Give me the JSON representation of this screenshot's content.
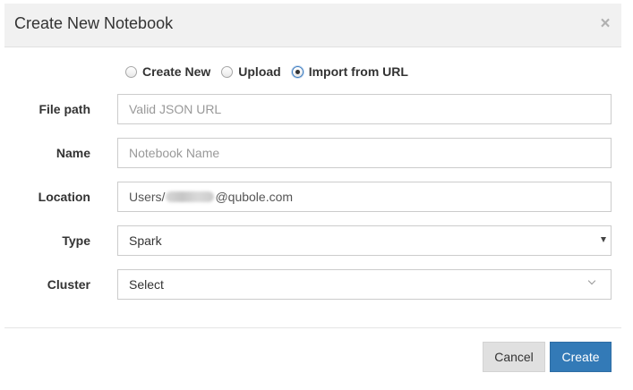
{
  "dialog": {
    "title": "Create New Notebook",
    "close_symbol": "×"
  },
  "source_options": [
    {
      "label": "Create New",
      "checked": false
    },
    {
      "label": "Upload",
      "checked": false
    },
    {
      "label": "Import from URL",
      "checked": true
    }
  ],
  "fields": {
    "file_path": {
      "label": "File path",
      "placeholder": "Valid JSON URL",
      "value": ""
    },
    "name": {
      "label": "Name",
      "placeholder": "Notebook Name",
      "value": ""
    },
    "location": {
      "label": "Location",
      "prefix": "Users/",
      "suffix": "@qubole.com"
    },
    "type": {
      "label": "Type",
      "selected": "Spark"
    },
    "cluster": {
      "label": "Cluster",
      "selected": "Select"
    }
  },
  "buttons": {
    "cancel": "Cancel",
    "create": "Create"
  },
  "colors": {
    "primary": "#337ab7",
    "header_bg": "#f1f1f1",
    "cancel_bg": "#e0e0e0"
  },
  "icons": {
    "close": "close-icon",
    "type_caret": "caret-down-icon",
    "cluster_chevron": "chevron-down-icon"
  }
}
